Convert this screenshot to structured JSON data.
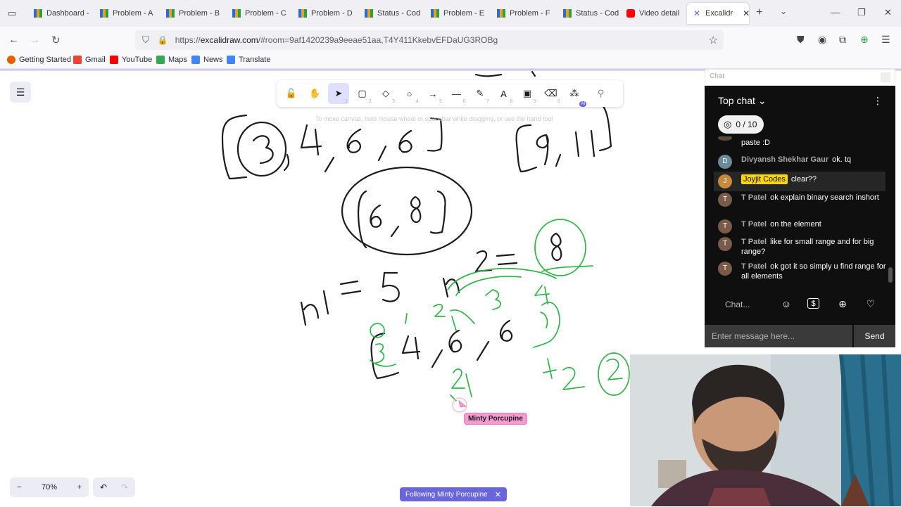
{
  "browser": {
    "tabs": [
      {
        "label": "Dashboard -",
        "icon": "chart-icon"
      },
      {
        "label": "Problem - A",
        "icon": "chart-icon"
      },
      {
        "label": "Problem - B",
        "icon": "chart-icon"
      },
      {
        "label": "Problem - C",
        "icon": "chart-icon"
      },
      {
        "label": "Problem - D",
        "icon": "chart-icon"
      },
      {
        "label": "Status - Cod",
        "icon": "chart-icon"
      },
      {
        "label": "Problem - E",
        "icon": "chart-icon"
      },
      {
        "label": "Problem - F",
        "icon": "chart-icon"
      },
      {
        "label": "Status - Cod",
        "icon": "chart-icon"
      },
      {
        "label": "Video detail",
        "icon": "youtube-icon"
      },
      {
        "label": "Excalidr",
        "icon": "excalidraw-icon",
        "active": true
      }
    ],
    "url_prefix": "https://",
    "url_host": "excalidraw.com",
    "url_rest": "/#room=9af1420239a9eeae51aa,T4Y411KkebvEFDaUG3ROBg",
    "bookmarks": [
      {
        "label": "Getting Started",
        "color": "#e66000"
      },
      {
        "label": "Gmail",
        "color": "#ea4335"
      },
      {
        "label": "YouTube",
        "color": "#ff0000"
      },
      {
        "label": "Maps",
        "color": "#34a853"
      },
      {
        "label": "News",
        "color": "#4285f4"
      },
      {
        "label": "Translate",
        "color": "#4285f4"
      }
    ]
  },
  "excalidraw": {
    "tools": [
      {
        "name": "lock",
        "glyph": "🔓",
        "num": ""
      },
      {
        "name": "hand",
        "glyph": "✋",
        "num": ""
      },
      {
        "name": "selection",
        "glyph": "➤",
        "num": "1",
        "active": true
      },
      {
        "name": "rectangle",
        "glyph": "▢",
        "num": "2"
      },
      {
        "name": "diamond",
        "glyph": "◇",
        "num": "3"
      },
      {
        "name": "ellipse",
        "glyph": "○",
        "num": "4"
      },
      {
        "name": "arrow",
        "glyph": "→",
        "num": "5"
      },
      {
        "name": "line",
        "glyph": "—",
        "num": "6"
      },
      {
        "name": "pencil",
        "glyph": "✎",
        "num": "7"
      },
      {
        "name": "text",
        "glyph": "A",
        "num": "8"
      },
      {
        "name": "image",
        "glyph": "▣",
        "num": "9"
      },
      {
        "name": "eraser",
        "glyph": "⌫",
        "num": "0"
      },
      {
        "name": "more-tools",
        "glyph": "⁂",
        "num": "",
        "badge": "AI"
      }
    ],
    "hint": "To move canvas, hold mouse wheel or spacebar while dragging, or use the hand tool",
    "zoom": "70%",
    "follow_label": "Following Minty Porcupine",
    "collaborator_name": "Minty Porcupine",
    "accent": "#6965db"
  },
  "chat": {
    "window_title": "Chat",
    "header": "Top chat",
    "goal": "0 / 10",
    "messages": [
      {
        "author": "",
        "text": "paste :D",
        "avatar": ""
      },
      {
        "author": "Divyansh Shekhar Gaur",
        "text": "ok. tq",
        "avatar": "D"
      },
      {
        "author": "Joyjit Codes",
        "text": "clear??",
        "avatar": "J",
        "owner": true
      },
      {
        "author": "T Patel",
        "text": "ok explain binary search inshort",
        "avatar": "T"
      },
      {
        "author": "T Patel",
        "text": "on the element",
        "avatar": "T"
      },
      {
        "author": "T Patel",
        "text": "like for small range and for big range?",
        "avatar": "T"
      },
      {
        "author": "T Patel",
        "text": "ok got it so simply u find range for all elements",
        "avatar": "T"
      }
    ],
    "chat_placeholder": "Chat...",
    "message_placeholder": "Enter message here...",
    "send_label": "Send"
  }
}
